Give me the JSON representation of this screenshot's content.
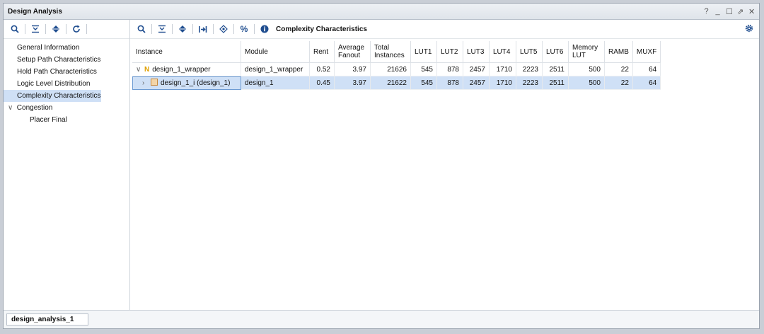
{
  "window": {
    "title": "Design Analysis",
    "controls": [
      "?",
      "_",
      "☐",
      "⇗",
      "✕"
    ]
  },
  "left_toolbar": {
    "icons": [
      "search-icon",
      "collapse-all-icon",
      "expand-all-icon",
      "refresh-icon"
    ]
  },
  "sidebar": {
    "items": [
      {
        "label": "General Information"
      },
      {
        "label": "Setup Path Characteristics"
      },
      {
        "label": "Hold Path Characteristics"
      },
      {
        "label": "Logic Level Distribution"
      },
      {
        "label": "Complexity Characteristics"
      }
    ],
    "group": {
      "label": "Congestion",
      "children": [
        {
          "label": "Placer Final"
        }
      ]
    }
  },
  "right_toolbar": {
    "title": "Complexity Characteristics",
    "percent": "%"
  },
  "table": {
    "headers": [
      "Instance",
      "Module",
      "Rent",
      "Average\nFanout",
      "Total\nInstances",
      "LUT1",
      "LUT2",
      "LUT3",
      "LUT4",
      "LUT5",
      "LUT6",
      "Memory\nLUT",
      "RAMB",
      "MUXF"
    ],
    "rows": [
      [
        "design_1_wrapper",
        "design_1_wrapper",
        "0.52",
        "3.97",
        "21626",
        "545",
        "878",
        "2457",
        "1710",
        "2223",
        "2511",
        "500",
        "22",
        "64"
      ],
      [
        "design_1_i (design_1)",
        "design_1",
        "0.45",
        "3.97",
        "21622",
        "545",
        "878",
        "2457",
        "1710",
        "2223",
        "2511",
        "500",
        "22",
        "64"
      ]
    ]
  },
  "bottom_tab": {
    "label": "design_analysis_1"
  }
}
